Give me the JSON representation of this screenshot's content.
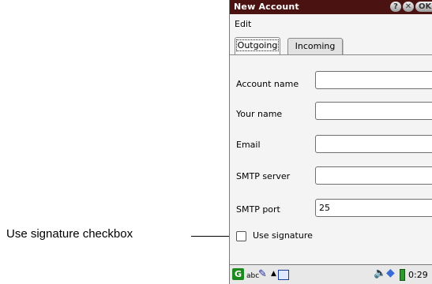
{
  "callout": {
    "label": "Use signature checkbox"
  },
  "window": {
    "title": "New Account",
    "buttons": {
      "help": "?",
      "close": "✕",
      "ok": "OK"
    }
  },
  "menu": {
    "edit": "Edit"
  },
  "tabs": [
    {
      "label": "Outgoing",
      "selected": true
    },
    {
      "label": "Incoming",
      "selected": false
    }
  ],
  "form": {
    "fields": [
      {
        "label": "Account name",
        "value": ""
      },
      {
        "label": "Your name",
        "value": ""
      },
      {
        "label": "Email",
        "value": ""
      },
      {
        "label": "SMTP server",
        "value": ""
      },
      {
        "label": "SMTP port",
        "value": "25"
      }
    ],
    "signature": {
      "label": "Use signature",
      "checked": false
    }
  },
  "taskbar": {
    "start": "G",
    "input_mode": "abc",
    "time": "0:29",
    "icons": [
      "start-icon",
      "pen-icon",
      "up-arrow-icon",
      "window-icon",
      "speaker-icon",
      "network-icon",
      "battery-icon"
    ]
  }
}
